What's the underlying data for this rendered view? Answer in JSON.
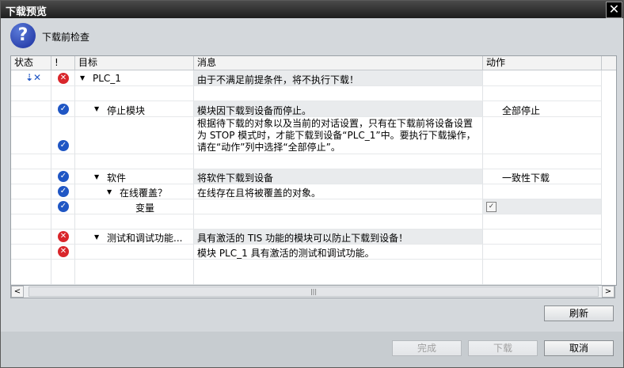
{
  "window": {
    "title": "下载预览",
    "close_label": "✕"
  },
  "header": {
    "text": "下载前检查",
    "icon": "question-icon"
  },
  "columns": [
    "状态",
    "!",
    "目标",
    "消息",
    "动作"
  ],
  "rows": [
    {
      "status_icon": "download-icon",
      "flag": "error",
      "target": "PLC_1",
      "message": "由于不满足前提条件，将不执行下载！",
      "action": ""
    },
    {
      "flag": "ok",
      "target": "停止模块",
      "message": "模块因下载到设备而停止。",
      "action": "全部停止"
    },
    {
      "flag": "ok",
      "target": "",
      "message": "根据待下载的对象以及当前的对话设置，只有在下载前将设备设置为 STOP 模式时，才能下载到设备“PLC_1”中。要执行下载操作，请在“动作”列中选择“全部停止”。",
      "action": ""
    },
    {
      "flag": "ok",
      "target": "软件",
      "message": "将软件下载到设备",
      "action": "一致性下载"
    },
    {
      "flag": "ok",
      "target": "在线覆盖？",
      "message": "在线存在且将被覆盖的对象。",
      "action": ""
    },
    {
      "flag": "ok",
      "target": "变量",
      "message": "",
      "action_checkbox": true
    },
    {
      "flag": "error",
      "target": "测试和调试功能...",
      "message": "具有激活的 TIS 功能的模块可以防止下载到设备！",
      "action": ""
    },
    {
      "flag": "error",
      "target": "",
      "message": "模块 PLC_1 具有激活的测试和调试功能。",
      "action": ""
    }
  ],
  "buttons": {
    "refresh": "刷新",
    "finish": "完成",
    "download": "下载",
    "cancel": "取消"
  },
  "scrollbar": {
    "left": "<",
    "right": ">",
    "grip": "|||"
  },
  "colors": {
    "ok": "#1f56c4",
    "error": "#d9262b"
  }
}
